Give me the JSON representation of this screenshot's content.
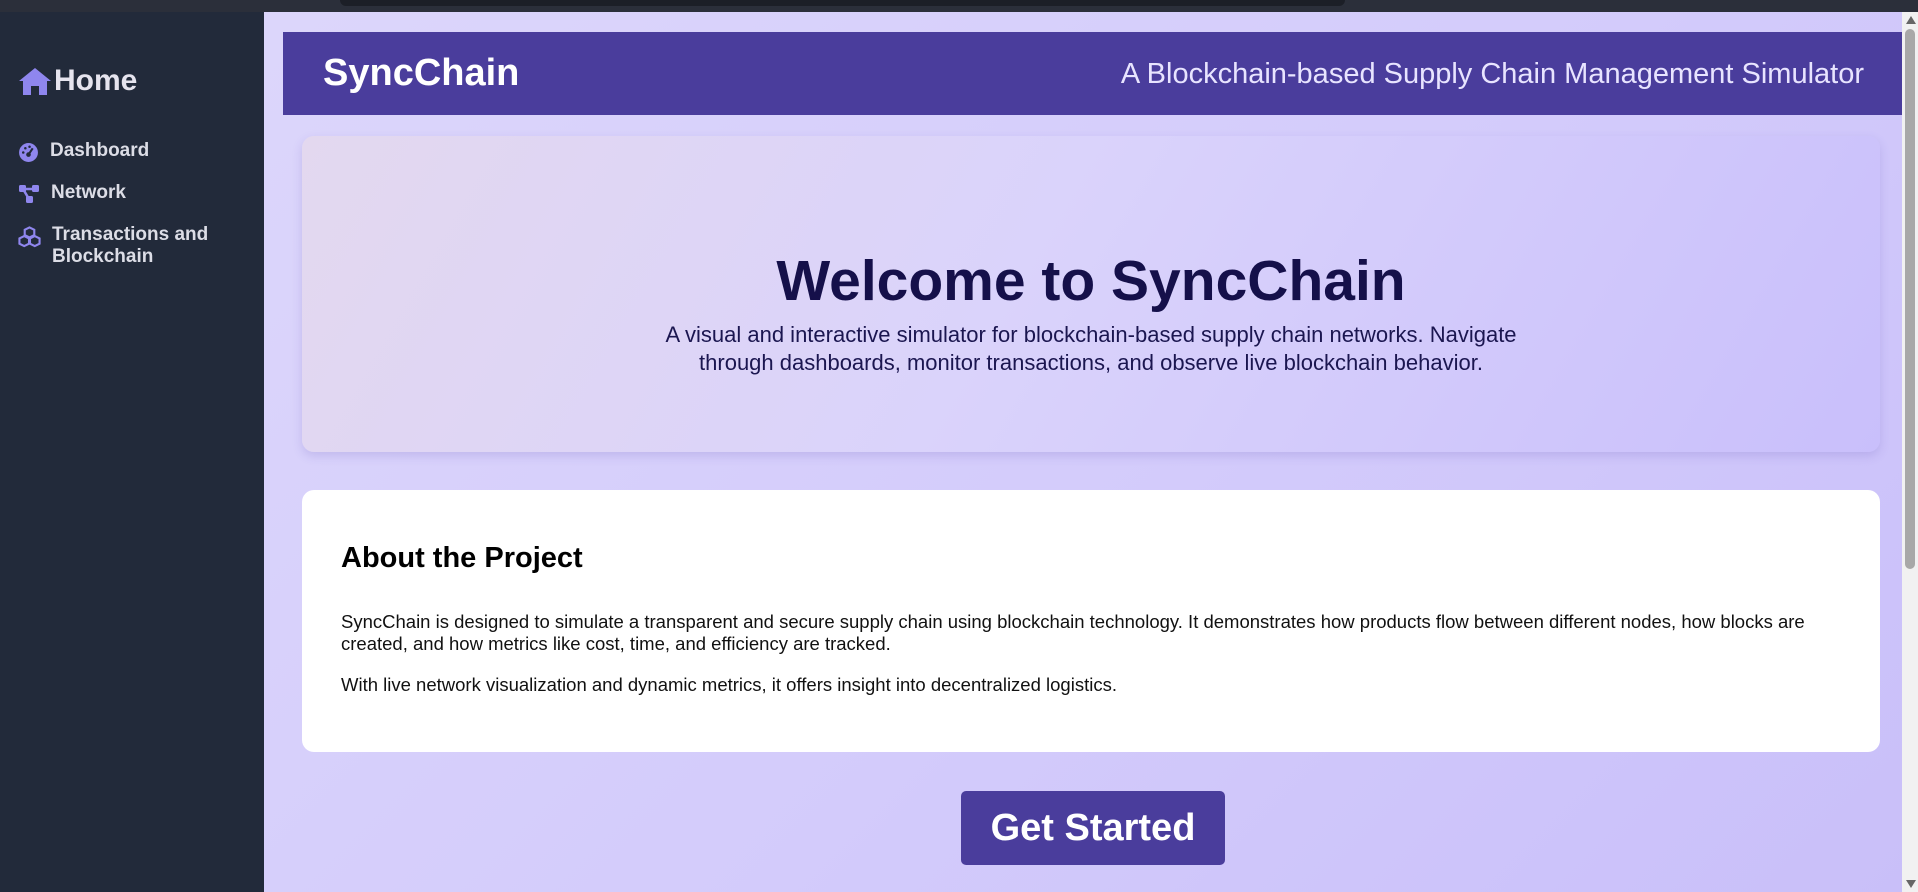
{
  "sidebar": {
    "home_label": "Home",
    "items": [
      {
        "label": "Dashboard",
        "icon": "gauge-icon"
      },
      {
        "label": "Network",
        "icon": "network-icon"
      },
      {
        "label": "Transactions and Blockchain",
        "icon": "cubes-icon"
      }
    ],
    "icon_color": "#8f86ee"
  },
  "header": {
    "brand": "SyncChain",
    "tagline": "A Blockchain-based Supply Chain Management Simulator"
  },
  "hero": {
    "title": "Welcome to SyncChain",
    "subtitle": "A visual and interactive simulator for blockchain-based supply chain networks. Navigate through dashboards, monitor transactions, and observe live blockchain behavior."
  },
  "about": {
    "heading": "About the Project",
    "paragraph1": "SyncChain is designed to simulate a transparent and secure supply chain using blockchain technology. It demonstrates how products flow between different nodes, how blocks are created, and how metrics like cost, time, and efficiency are tracked.",
    "paragraph2": "With live network visualization and dynamic metrics, it offers insight into decentralized logistics."
  },
  "cta": {
    "label": "Get Started"
  },
  "colors": {
    "primary": "#4a3d9c",
    "sidebar_bg": "#222a3a",
    "page_bg": "#d7d0fb"
  }
}
